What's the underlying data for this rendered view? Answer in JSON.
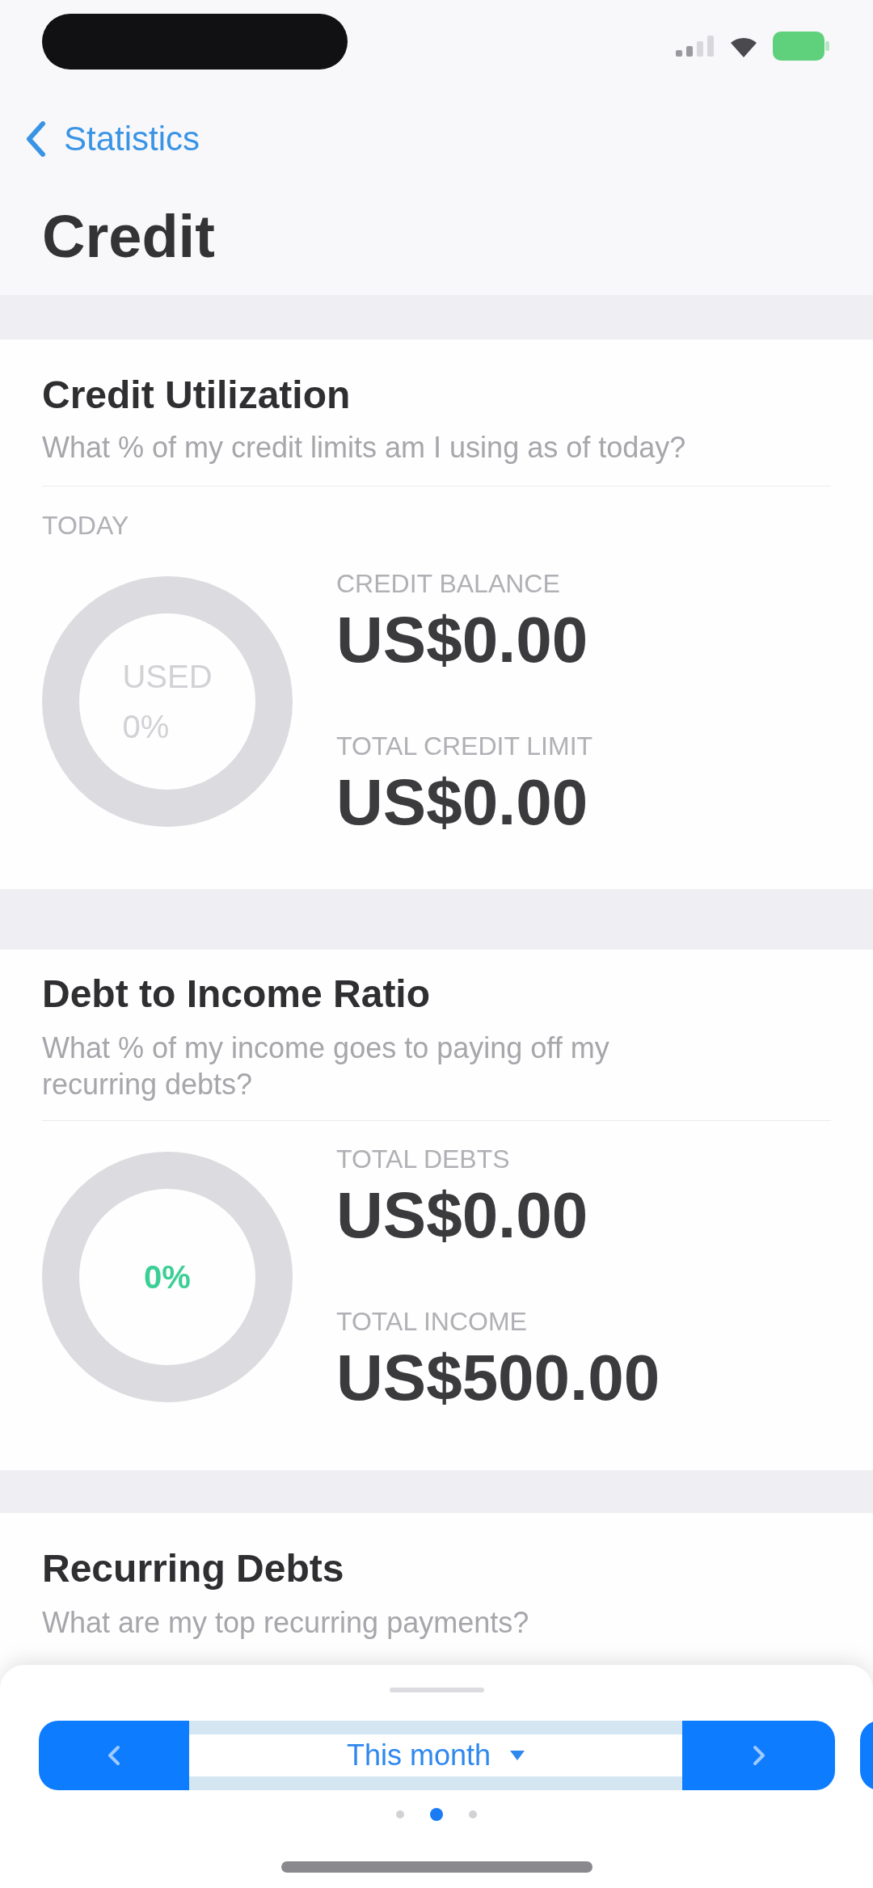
{
  "nav": {
    "back_label": "Statistics",
    "title": "Credit"
  },
  "cards": [
    {
      "title": "Credit Utilization",
      "subtitle": "What % of my credit limits am I using as of today?",
      "period_label": "TODAY",
      "donut": {
        "label": "USED",
        "value": "0%",
        "color": "#d2d2d6"
      },
      "metrics": [
        {
          "label": "CREDIT BALANCE",
          "value": "US$0.00"
        },
        {
          "label": "TOTAL CREDIT LIMIT",
          "value": "US$0.00"
        }
      ]
    },
    {
      "title": "Debt to Income Ratio",
      "subtitle": "What % of my income goes to paying off my recurring debts?",
      "donut": {
        "value": "0%",
        "color": "#3ccf95"
      },
      "metrics": [
        {
          "label": "TOTAL DEBTS",
          "value": "US$0.00"
        },
        {
          "label": "TOTAL INCOME",
          "value": "US$500.00"
        }
      ]
    },
    {
      "title": "Recurring Debts",
      "subtitle": "What are my top recurring payments?"
    }
  ],
  "period_picker": {
    "label": "This month"
  },
  "page_dots": [
    {
      "selected": false
    },
    {
      "selected": true
    },
    {
      "selected": false
    }
  ]
}
